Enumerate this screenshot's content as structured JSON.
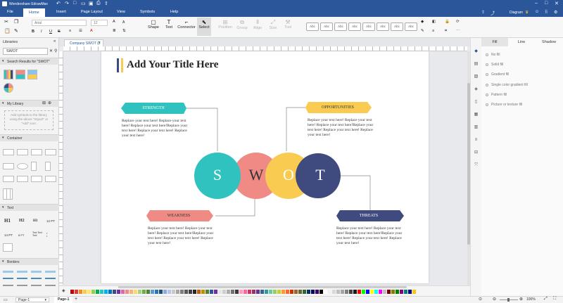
{
  "app": {
    "title": "Wondershare EdrawMax"
  },
  "menu": {
    "file": "File",
    "home": "Home",
    "insert": "Insert",
    "page_layout": "Page Layout",
    "view": "View",
    "symbols": "Symbols",
    "help": "Help"
  },
  "account": {
    "publish": "Publish",
    "share": "Share",
    "diagram": "Diagram"
  },
  "ribbon": {
    "font_name": "Arial",
    "font_size": "12",
    "shape": "Shape",
    "text": "Text",
    "connector": "Connector",
    "select": "Select",
    "position": "Position",
    "group": "Group",
    "align": "Align",
    "size": "Size",
    "tool": "Tool",
    "style_label": "Abc"
  },
  "left": {
    "libraries": "Libraries",
    "search_value": "SWOT",
    "search_results": "Search Results for \"SWOT\"",
    "my_library": "My Library",
    "my_library_hint": "Add symbols to the library using the above \"Import\" or \"Add\" icon.",
    "container": "Container",
    "text_section": "Text",
    "borders": "Borders",
    "h1": "H1",
    "h2": "H2",
    "h3": "H3",
    "h1pt": "12 PT",
    "h14pt": "14 PT",
    "h8pt": "8 PT",
    "tt": "Text Text Text"
  },
  "doc": {
    "tab": "Company SWOT (2"
  },
  "diagram": {
    "title": "Add Your Title Here",
    "strength": "STRENGTH",
    "opportunities": "OPPORTUNITIES",
    "weakness": "WEAKNESS",
    "threats": "THREATS",
    "s": "S",
    "w": "W",
    "o": "O",
    "t": "T",
    "body": "Replace your text here!  Replace your text here!  Replace your text here!Replace your text here!  Replace your text here!  Replace your text here!"
  },
  "right": {
    "tabs": {
      "fill": "Fill",
      "line": "Line",
      "shadow": "Shadow"
    },
    "options": [
      "No fill",
      "Solid fill",
      "Gradient fill",
      "Single color gradient fill",
      "Pattern fill",
      "Picture or texture fill"
    ]
  },
  "status": {
    "page_selector": "Page-1",
    "page_tab": "Page-1",
    "zoom": "100%"
  },
  "colors": {
    "brand": "#2b579a",
    "strength": "#2fc2bf",
    "weakness": "#f08a84",
    "opportunities": "#f9cb50",
    "threats": "#3f4a7e"
  }
}
